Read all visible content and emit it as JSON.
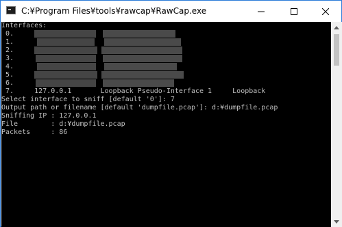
{
  "window": {
    "title": "C:¥Program Files¥tools¥rawcap¥RawCap.exe",
    "icon": "console-app-icon",
    "controls": [
      "minimize-icon",
      "maximize-icon",
      "close-icon"
    ]
  },
  "console": {
    "lines": [
      "Interfaces:",
      " 0.",
      " 1.",
      " 2.",
      " 3.",
      " 4.",
      " 5.",
      " 6.",
      " 7.     127.0.0.1       Loopback Pseudo-Interface 1     Loopback",
      "Select interface to sniff [default '0']: 7",
      "Output path or filename [default 'dumpfile.pcap']: d:¥dumpfile.pcap",
      "Sniffing IP : 127.0.0.1",
      "File        : d:¥dumpfile.pcap",
      "Packets     : 86"
    ],
    "text_color": "#c0c0c0",
    "background": "#000000"
  },
  "scrollbar": {
    "up_icon": "scroll-up-arrow-icon",
    "down_icon": "scroll-down-arrow-icon"
  }
}
